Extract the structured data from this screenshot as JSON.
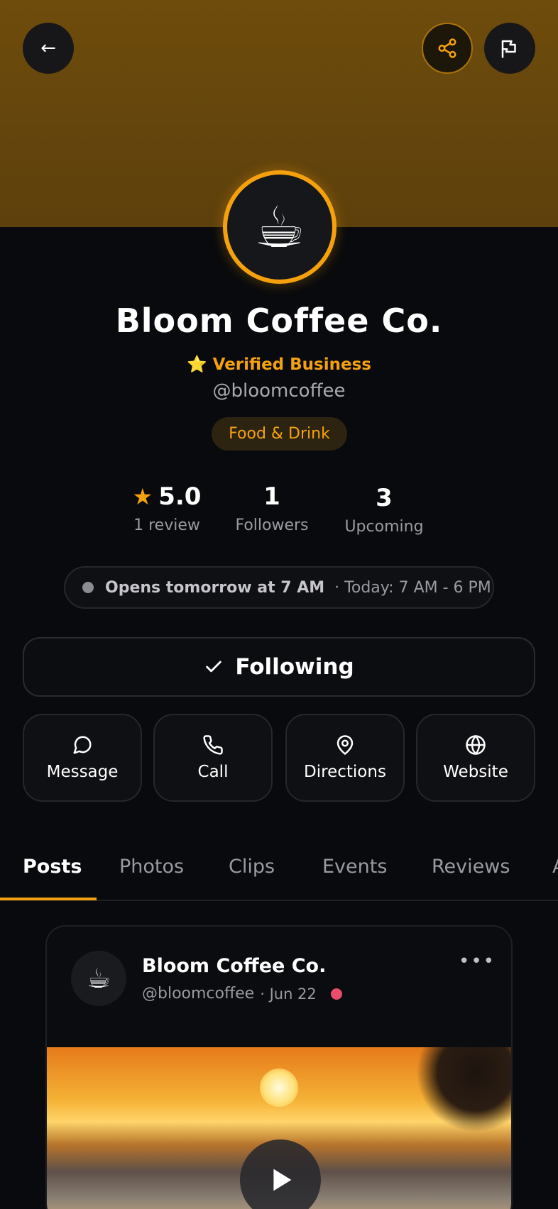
{
  "header": {
    "back_glyph": "←",
    "icons": [
      "arrow-left",
      "share-nodes",
      "flag"
    ]
  },
  "profile": {
    "avatar_emoji": "☕",
    "name": "Bloom Coffee Co.",
    "verified_label": "⭐ Verified Business",
    "handle": "@bloomcoffee",
    "category": "Food & Drink"
  },
  "stats": [
    {
      "value": "5.0",
      "label": "1 review",
      "icon": "star-icon"
    },
    {
      "value": "1",
      "label": "Followers"
    },
    {
      "value": "3",
      "label": "Upcoming"
    }
  ],
  "hours": {
    "status": "Opens tomorrow at 7 AM",
    "today": "· Today: 7 AM - 6 PM"
  },
  "follow_button": {
    "label": "Following"
  },
  "actions": [
    {
      "label": "Message",
      "icon": "chat-bubble-icon"
    },
    {
      "label": "Call",
      "icon": "phone-icon"
    },
    {
      "label": "Directions",
      "icon": "map-pin-icon"
    },
    {
      "label": "Website",
      "icon": "globe-icon"
    }
  ],
  "tabs": [
    {
      "label": "Posts",
      "active": true
    },
    {
      "label": "Photos"
    },
    {
      "label": "Clips"
    },
    {
      "label": "Events"
    },
    {
      "label": "Reviews"
    },
    {
      "label": "A"
    }
  ],
  "post": {
    "author": "Bloom Coffee Co.",
    "handle": "@bloomcoffee",
    "date": "· Jun 22",
    "more_glyph": "•••",
    "avatar_emoji": "☕"
  },
  "colors": {
    "accent": "#f5a10d",
    "background": "#090a0d",
    "banner": "#6e4c0c",
    "live_dot": "#ec4d6c"
  }
}
